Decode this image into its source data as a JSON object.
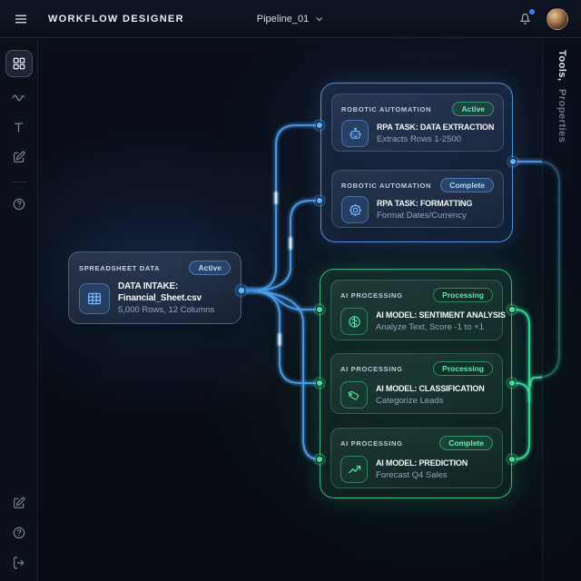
{
  "topbar": {
    "title": "WORKFLOW DESIGNER",
    "pipeline_selector": "Pipeline_01"
  },
  "right_panel": {
    "label_primary": "Tools,",
    "label_secondary": "Properties"
  },
  "nodes": {
    "spreadsheet": {
      "category": "SPREADSHEET DATA",
      "status": "Active",
      "title_line1": "DATA INTAKE:",
      "title_line2": "Financial_Sheet.csv",
      "subtitle": "5,000 Rows, 12 Columns"
    },
    "rpa_extraction": {
      "category": "ROBOTIC AUTOMATION",
      "status": "Active",
      "title": "RPA TASK: DATA EXTRACTION",
      "subtitle": "Extracts Rows 1-2500"
    },
    "rpa_formatting": {
      "category": "ROBOTIC AUTOMATION",
      "status": "Complete",
      "title": "RPA TASK: FORMATTING",
      "subtitle": "Format Dates/Currency"
    },
    "ai_sentiment": {
      "category": "AI PROCESSING",
      "status": "Processing",
      "title": "AI MODEL: SENTIMENT ANALYSIS",
      "subtitle": "Analyze Text, Score -1 to +1"
    },
    "ai_classification": {
      "category": "AI PROCESSING",
      "status": "Processing",
      "title": "AI MODEL: CLASSIFICATION",
      "subtitle": "Categorize Leads"
    },
    "ai_prediction": {
      "category": "AI PROCESSING",
      "status": "Complete",
      "title": "AI MODEL: PREDICTION",
      "subtitle": "Forecast Q4 Sales"
    }
  },
  "icons": {
    "topbar": [
      "hamburger-menu",
      "chevron-down",
      "bell",
      "avatar"
    ],
    "sidebar_top": [
      "blocks-grid",
      "signal-wave",
      "text-tool",
      "edit-pen",
      "help-circle"
    ],
    "sidebar_bottom": [
      "edit-pen",
      "help-circle",
      "logout"
    ],
    "node_icons": {
      "spreadsheet": "table-grid",
      "rpa_extraction": "robot",
      "rpa_formatting": "gear",
      "ai_sentiment": "brain",
      "ai_classification": "tag",
      "ai_prediction": "trend-up"
    }
  },
  "colors": {
    "accent_blue": "#4da3f7",
    "accent_green": "#3ae2a0",
    "badge_blue_text": "#b5d8ff",
    "badge_green_text": "#66f0b6",
    "notification_dot": "#3b82f6",
    "background": "#070b13"
  }
}
